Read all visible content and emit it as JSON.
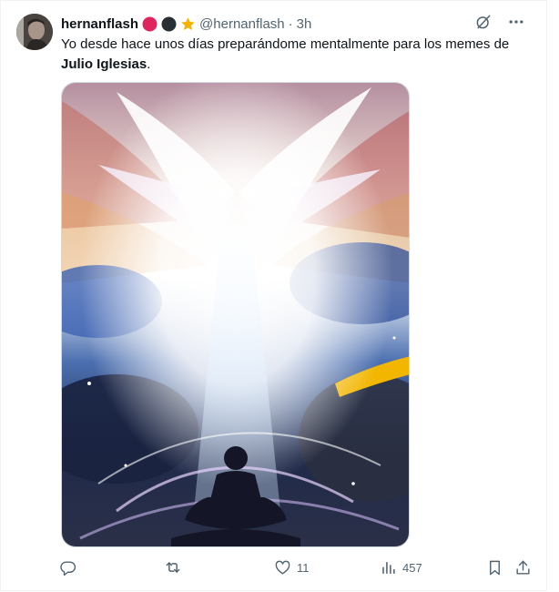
{
  "post": {
    "author_name": "hernanflash",
    "handle": "@hernanflash",
    "separator": "·",
    "time": "3h",
    "text_before": "Yo desde hace unos días preparándome mentalmente para los memes de ",
    "text_bold": "Julio Iglesias",
    "text_after": ".",
    "badges": [
      "red-circle-icon",
      "black-circle-icon",
      "star-icon"
    ],
    "media_description_icon": "meditation-artwork"
  },
  "metrics": {
    "likes": "11",
    "views": "457"
  },
  "icons": {
    "grok": "grok-icon",
    "more": "more-icon",
    "reply": "reply-icon",
    "repost": "repost-icon",
    "like": "heart-icon",
    "views": "views-icon",
    "bookmark": "bookmark-icon",
    "share": "share-icon"
  },
  "colors": {
    "text_primary": "#0f1419",
    "text_secondary": "#536471",
    "badge_red": "#e0245e",
    "badge_dark": "#292f33",
    "badge_star": "#f4b400"
  }
}
